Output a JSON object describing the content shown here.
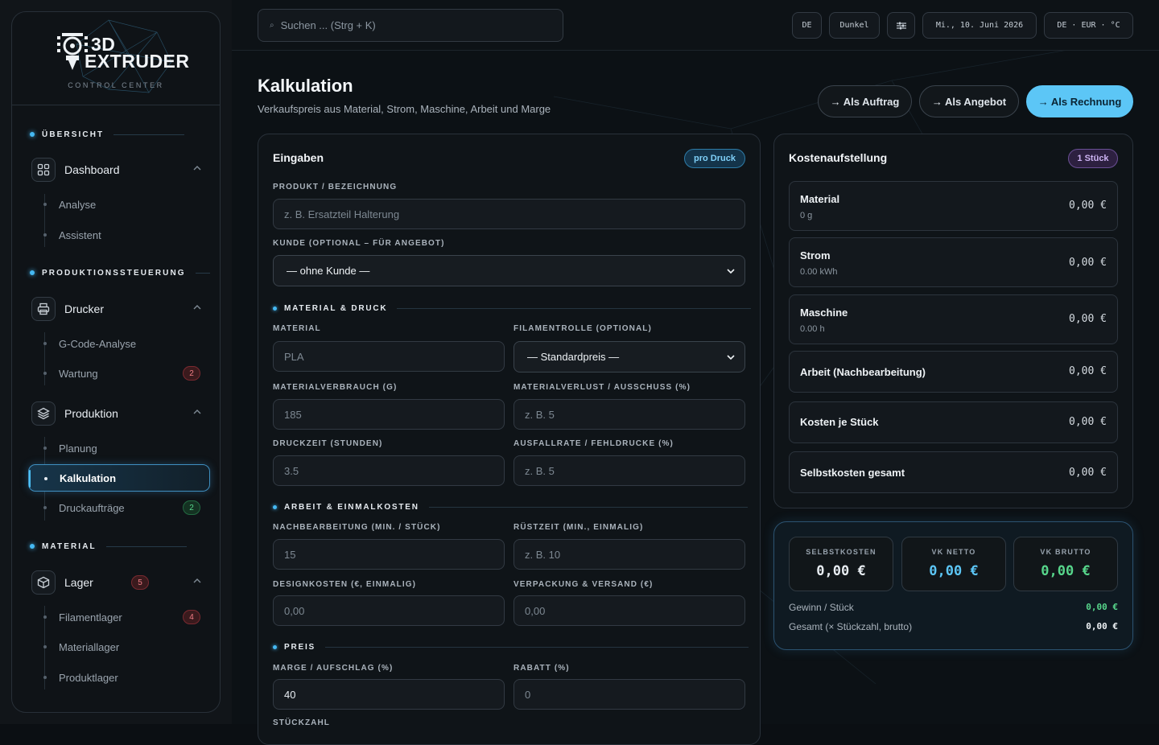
{
  "brand": {
    "line1": "3D",
    "line2": "EXTRUDER",
    "subtitle": "CONTROL CENTER"
  },
  "sidebar": {
    "sections": [
      {
        "label": "ÜBERSICHT"
      },
      {
        "label": "PRODUKTIONSSTEUERUNG"
      },
      {
        "label": "MATERIAL"
      }
    ],
    "groups": {
      "dashboard": {
        "label": "Dashboard",
        "items": [
          "Analyse",
          "Assistent"
        ]
      },
      "drucker": {
        "label": "Drucker",
        "items": [
          "G-Code-Analyse",
          "Wartung"
        ],
        "wartung_count": "2"
      },
      "produktion": {
        "label": "Produktion",
        "items": [
          "Planung",
          "Kalkulation",
          "Druckaufträge"
        ],
        "druckauftraege_count": "2"
      },
      "lager": {
        "label": "Lager",
        "count": "5",
        "items": [
          "Filamentlager",
          "Materiallager",
          "Produktlager"
        ],
        "filament_count": "4"
      }
    }
  },
  "topbar": {
    "search_placeholder": "Suchen ... (Strg + K)",
    "lang": "DE",
    "theme": "Dunkel",
    "filter_icon": "sliders-icon",
    "date": "Mi., 10. Juni 2026",
    "locale": "DE · EUR · °C"
  },
  "page": {
    "title": "Kalkulation",
    "subtitle": "Verkaufspreis aus Material, Strom, Maschine, Arbeit und Marge",
    "actions": [
      "→ Als Auftrag",
      "→ Als Angebot",
      "→ Als Rechnung"
    ]
  },
  "inputs": {
    "title": "Eingaben",
    "badge": "pro Druck",
    "product_label": "PRODUKT / BEZEICHNUNG",
    "product_placeholder": "z. B. Ersatzteil Halterung",
    "customer_label": "KUNDE (OPTIONAL – FÜR ANGEBOT)",
    "customer_value": "— ohne Kunde —",
    "sec_material": "MATERIAL & DRUCK",
    "material_label": "MATERIAL",
    "material_placeholder": "PLA",
    "spool_label": "FILAMENTROLLE (OPTIONAL)",
    "spool_value": "— Standardpreis —",
    "usage_label": "MATERIALVERBRAUCH (G)",
    "usage_placeholder": "185",
    "loss_label": "MATERIALVERLUST / AUSSCHUSS (%)",
    "loss_placeholder": "z. B. 5",
    "time_label": "DRUCKZEIT (STUNDEN)",
    "time_placeholder": "3.5",
    "fail_label": "AUSFALLRATE / FEHLDRUCKE (%)",
    "fail_placeholder": "z. B. 5",
    "sec_work": "ARBEIT & EINMALKOSTEN",
    "post_label": "NACHBEARBEITUNG (MIN. / STÜCK)",
    "post_placeholder": "15",
    "setup_label": "RÜSTZEIT (MIN., EINMALIG)",
    "setup_placeholder": "z. B. 10",
    "design_label": "DESIGNKOSTEN (€, EINMALIG)",
    "design_placeholder": "0,00",
    "pack_label": "VERPACKUNG & VERSAND (€)",
    "pack_placeholder": "0,00",
    "sec_price": "PREIS",
    "margin_label": "MARGE / AUFSCHLAG (%)",
    "margin_value": "40",
    "discount_label": "RABATT (%)",
    "discount_placeholder": "0",
    "qty_label": "STÜCKZAHL"
  },
  "costs": {
    "title": "Kostenaufstellung",
    "badge": "1 Stück",
    "rows": [
      {
        "label": "Material",
        "sub": "0 g",
        "value": "0,00 €"
      },
      {
        "label": "Strom",
        "sub": "0.00 kWh",
        "value": "0,00 €"
      },
      {
        "label": "Maschine",
        "sub": "0.00 h",
        "value": "0,00 €"
      },
      {
        "label": "Arbeit (Nachbearbeitung)",
        "value": "0,00 €"
      },
      {
        "label": "Kosten je Stück",
        "value": "0,00 €"
      },
      {
        "label": "Selbstkosten gesamt",
        "value": "0,00 €"
      }
    ]
  },
  "summary": {
    "kpis": [
      {
        "label": "SELBSTKOSTEN",
        "value": "0,00 €",
        "color": "#e8edf2"
      },
      {
        "label": "VK NETTO",
        "value": "0,00 €",
        "color": "#5cc6f6"
      },
      {
        "label": "VK BRUTTO",
        "value": "0,00 €",
        "color": "#57d68b"
      }
    ],
    "profit_label": "Gewinn / Stück",
    "profit_value": "0,00 €",
    "total_label": "Gesamt (× Stückzahl, brutto)",
    "total_value": "0,00 €"
  },
  "colors": {
    "accent": "#5cc6f6",
    "success": "#57d68b",
    "danger": "#f07d85"
  }
}
